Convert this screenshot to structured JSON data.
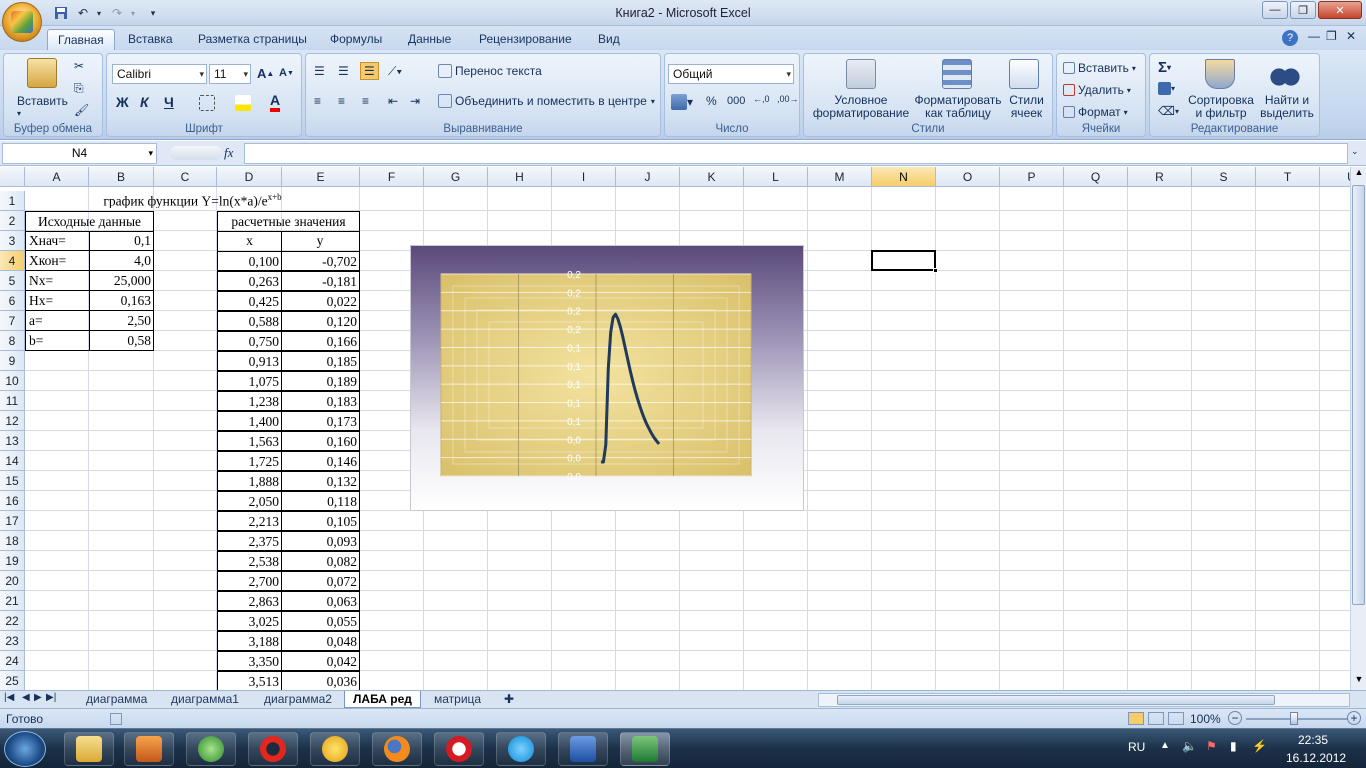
{
  "window": {
    "title": "Книга2 - Microsoft Excel",
    "min_label": "—",
    "max_label": "❐",
    "close_label": "✕"
  },
  "ribbon_tabs": [
    "Главная",
    "Вставка",
    "Разметка страницы",
    "Формулы",
    "Данные",
    "Рецензирование",
    "Вид"
  ],
  "clipboard": {
    "paste_label": "Вставить",
    "group_label": "Буфер обмена"
  },
  "font": {
    "name": "Calibri",
    "size": "11",
    "bold": "Ж",
    "italic": "К",
    "underline": "Ч",
    "group_label": "Шрифт"
  },
  "alignment": {
    "wrap_label": "Перенос текста",
    "merge_label": "Объединить и поместить в центре",
    "group_label": "Выравнивание"
  },
  "number": {
    "format": "Общий",
    "percent": "%",
    "thousands": "000",
    "group_label": "Число"
  },
  "styles": {
    "conditional": "Условное форматирование",
    "as_table": "Форматировать как таблицу",
    "cell_styles": "Стили ячеек",
    "group_label": "Стили"
  },
  "cells": {
    "insert": "Вставить",
    "delete": "Удалить",
    "format": "Формат",
    "group_label": "Ячейки"
  },
  "editing": {
    "sort": "Сортировка и фильтр",
    "find": "Найти и выделить",
    "group_label": "Редактирование"
  },
  "formula_bar": {
    "name_box": "N4",
    "fx": "fx",
    "formula": ""
  },
  "columns": [
    "A",
    "B",
    "C",
    "D",
    "E",
    "F",
    "G",
    "H",
    "I",
    "J",
    "K",
    "L",
    "M",
    "N",
    "O",
    "P",
    "Q",
    "R",
    "S",
    "T",
    "U"
  ],
  "rows": [
    "1",
    "2",
    "3",
    "4",
    "5",
    "6",
    "7",
    "8",
    "9",
    "10",
    "11",
    "12",
    "13",
    "14",
    "15",
    "16",
    "17",
    "18",
    "19",
    "20",
    "21",
    "22",
    "23",
    "24",
    "25"
  ],
  "sheet": {
    "title_prefix": "график функции Y=ln(x*a)/e",
    "title_sup": "x+b",
    "input_header": "Исходные данные",
    "calc_header": "расчетные значения",
    "x_header": "x",
    "y_header": "y",
    "inputs": [
      {
        "label": "Xнач=",
        "value": "0,1"
      },
      {
        "label": "Xкон=",
        "value": "4,0"
      },
      {
        "label": "Nx=",
        "value": "25,000"
      },
      {
        "label": "Hx=",
        "value": "0,163"
      },
      {
        "label": "a=",
        "value": "2,50"
      },
      {
        "label": "b=",
        "value": "0,58"
      }
    ],
    "table": [
      {
        "x": "0,100",
        "y": "-0,702"
      },
      {
        "x": "0,263",
        "y": "-0,181"
      },
      {
        "x": "0,425",
        "y": "0,022"
      },
      {
        "x": "0,588",
        "y": "0,120"
      },
      {
        "x": "0,750",
        "y": "0,166"
      },
      {
        "x": "0,913",
        "y": "0,185"
      },
      {
        "x": "1,075",
        "y": "0,189"
      },
      {
        "x": "1,238",
        "y": "0,183"
      },
      {
        "x": "1,400",
        "y": "0,173"
      },
      {
        "x": "1,563",
        "y": "0,160"
      },
      {
        "x": "1,725",
        "y": "0,146"
      },
      {
        "x": "1,888",
        "y": "0,132"
      },
      {
        "x": "2,050",
        "y": "0,118"
      },
      {
        "x": "2,213",
        "y": "0,105"
      },
      {
        "x": "2,375",
        "y": "0,093"
      },
      {
        "x": "2,538",
        "y": "0,082"
      },
      {
        "x": "2,700",
        "y": "0,072"
      },
      {
        "x": "2,863",
        "y": "0,063"
      },
      {
        "x": "3,025",
        "y": "0,055"
      },
      {
        "x": "3,188",
        "y": "0,048"
      },
      {
        "x": "3,350",
        "y": "0,042"
      },
      {
        "x": "3,513",
        "y": "0,036"
      }
    ]
  },
  "chart_data": {
    "type": "line",
    "title": "",
    "xlabel": "",
    "ylabel": "",
    "y_tick_labels": [
      "0,2",
      "0,2",
      "0,2",
      "0,2",
      "0,1",
      "0,1",
      "0,1",
      "0,1",
      "0,1",
      "0,0",
      "0,0",
      "0,0"
    ],
    "x": [
      0.1,
      0.263,
      0.425,
      0.588,
      0.75,
      0.913,
      1.075,
      1.238,
      1.4,
      1.563,
      1.725,
      1.888,
      2.05,
      2.213,
      2.375,
      2.538,
      2.7,
      2.863,
      3.025,
      3.188,
      3.35,
      3.513,
      3.675,
      3.838,
      4.0
    ],
    "series": [
      {
        "values": [
          -0.702,
          -0.181,
          0.022,
          0.12,
          0.166,
          0.185,
          0.189,
          0.183,
          0.173,
          0.16,
          0.146,
          0.132,
          0.118,
          0.105,
          0.093,
          0.082,
          0.072,
          0.063,
          0.055,
          0.048,
          0.042,
          0.036,
          0.031,
          0.027,
          0.023
        ]
      }
    ],
    "ylim": [
      0.0,
      0.22
    ],
    "grid": true,
    "line_color": "#1f3a5a",
    "plot_fill": "#d9c06a"
  },
  "sheet_tabs": [
    "диаграмма",
    "диаграмма1",
    "диаграмма2",
    "ЛАБА ред",
    "матрица"
  ],
  "active_sheet": "ЛАБА ред",
  "status": {
    "ready": "Готово",
    "zoom": "100%"
  },
  "taskbar": {
    "lang": "RU",
    "time": "22:35",
    "date": "16.12.2012"
  }
}
